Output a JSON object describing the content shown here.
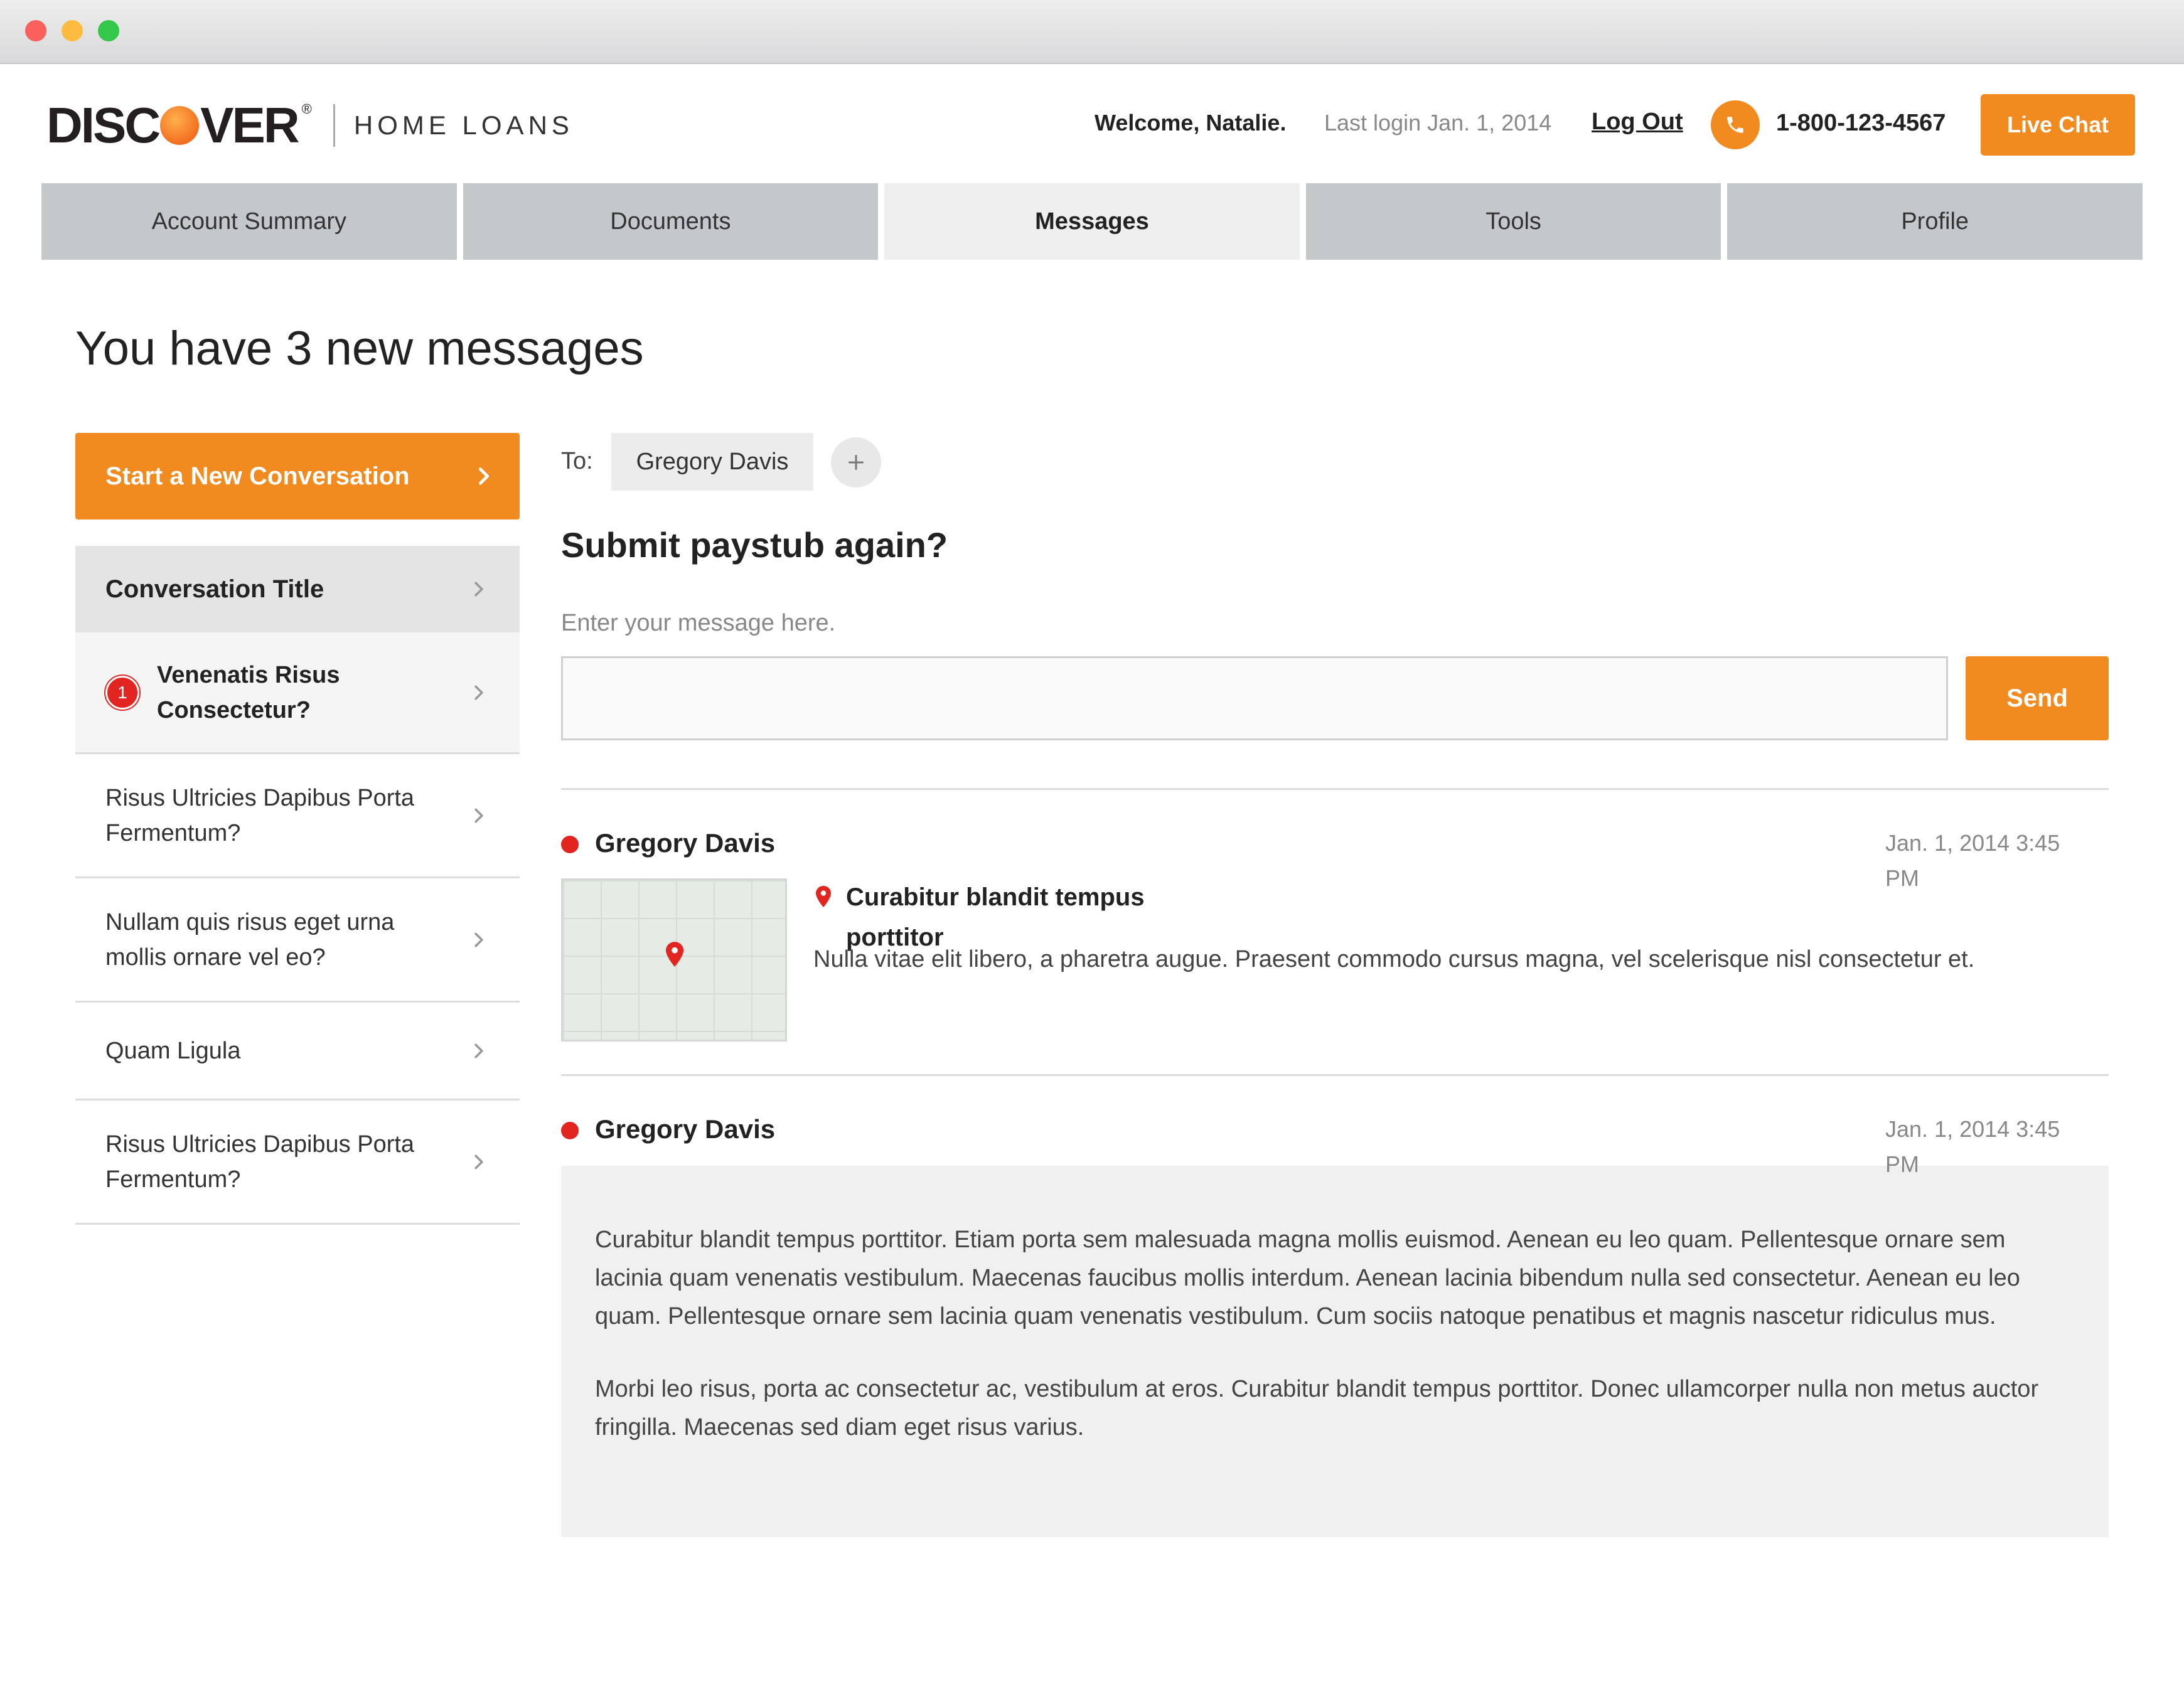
{
  "window": {
    "controls": [
      "close",
      "minimize",
      "maximize"
    ]
  },
  "brand": {
    "logo_left": "DISC",
    "logo_right": "VER",
    "registered": "®",
    "subtitle": "HOME LOANS",
    "accent": "#f28b1f"
  },
  "header": {
    "welcome": "Welcome, Natalie.",
    "last_login": "Last login Jan. 1, 2014",
    "logout": "Log Out",
    "phone_icon": "phone-icon",
    "phone": "1-800-123-4567",
    "live_chat": "Live Chat"
  },
  "tabs": [
    {
      "label": "Account Summary",
      "active": false
    },
    {
      "label": "Documents",
      "active": false
    },
    {
      "label": "Messages",
      "active": true
    },
    {
      "label": "Tools",
      "active": false
    },
    {
      "label": "Profile",
      "active": false
    }
  ],
  "page_title": "You have 3 new messages",
  "sidebar": {
    "new_conversation": "Start a New Conversation",
    "list_header": "Conversation Title",
    "conversations": [
      {
        "title": "Venenatis Risus Consectetur?",
        "unread_count": "1"
      },
      {
        "title": "Risus Ultricies Dapibus Porta Fermentum?"
      },
      {
        "title": "Nullam quis risus eget urna mollis ornare vel eo?"
      },
      {
        "title": "Quam Ligula"
      },
      {
        "title": "Risus Ultricies Dapibus Porta Fermentum?"
      }
    ]
  },
  "compose": {
    "to_label": "To:",
    "recipient": "Gregory Davis",
    "subject": "Submit paystub again?",
    "message_label": "Enter your message here.",
    "message_value": "",
    "send": "Send"
  },
  "messages": [
    {
      "sender": "Gregory Davis",
      "timestamp": "Jan. 1, 2014 3:45 PM",
      "attachment_title": "Curabitur blandit tempus porttitor",
      "attachment_text": "Nulla vitae elit libero, a pharetra augue. Praesent commodo cursus magna, vel scelerisque nisl consectetur et."
    },
    {
      "sender": "Gregory Davis",
      "timestamp": "Jan. 1, 2014 3:45 PM",
      "paragraphs": [
        "Curabitur blandit tempus porttitor. Etiam porta sem malesuada magna mollis euismod. Aenean eu leo quam. Pellentesque ornare sem lacinia quam venenatis vestibulum. Maecenas faucibus mollis interdum. Aenean lacinia bibendum nulla sed consectetur. Aenean eu leo quam. Pellentesque ornare sem lacinia quam venenatis vestibulum. Cum sociis natoque penatibus et magnis nascetur ridiculus mus.",
        "Morbi leo risus, porta ac consectetur ac, vestibulum at eros. Curabitur blandit tempus porttitor. Donec ullamcorper nulla non metus auctor fringilla. Maecenas sed diam eget risus varius."
      ]
    }
  ]
}
